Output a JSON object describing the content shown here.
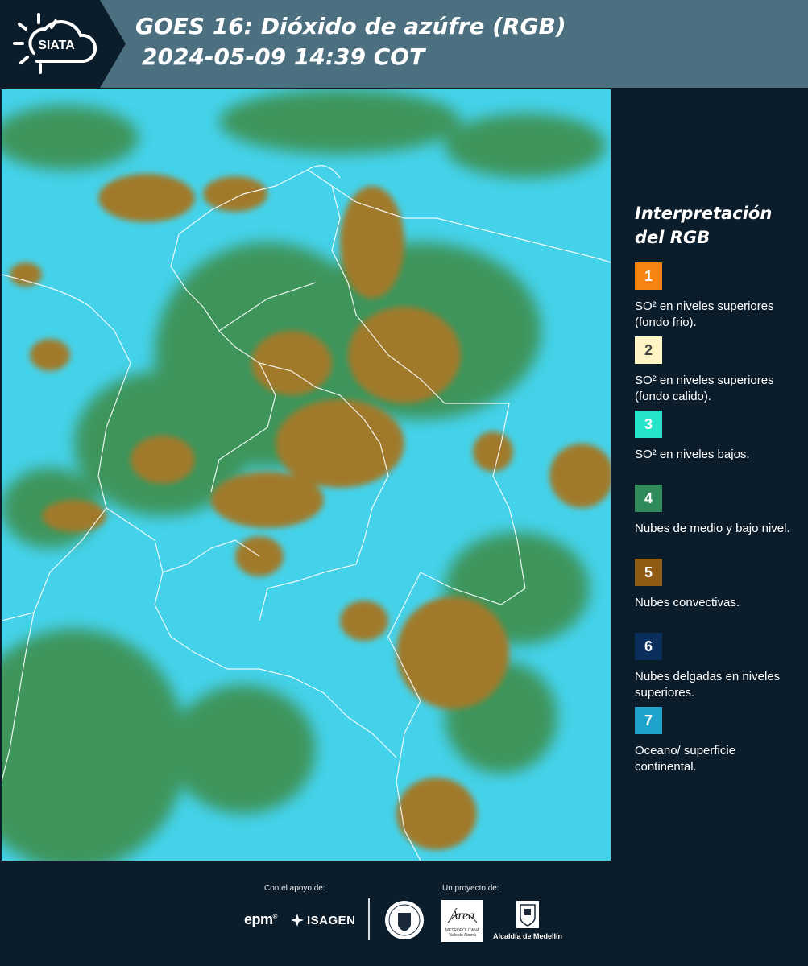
{
  "header": {
    "logo_text": "SIATA",
    "title_line1": "GOES 16: Dióxido de azúfre (RGB)",
    "title_line2": "2024-05-09 14:39 COT"
  },
  "legend": {
    "title_line1": "Interpretación",
    "title_line2": "del RGB",
    "items": [
      {
        "number": "1",
        "label": "SO² en niveles superiores (fondo frio).",
        "color": "#f58410",
        "text_color": "#ffffff"
      },
      {
        "number": "2",
        "label": "SO² en niveles superiores (fondo calido).",
        "color": "#fdf5c3",
        "text_color": "#444444"
      },
      {
        "number": "3",
        "label": "SO² en niveles bajos.",
        "color": "#23e3c8",
        "text_color": "#ffffff"
      },
      {
        "number": "4",
        "label": "Nubes de medio y bajo nivel.",
        "color": "#2f8a5c",
        "text_color": "#ffffff"
      },
      {
        "number": "5",
        "label": "Nubes convectivas.",
        "color": "#8f5b15",
        "text_color": "#ffffff"
      },
      {
        "number": "6",
        "label": "Nubes delgadas en niveles superiores.",
        "color": "#0a2f5c",
        "text_color": "#ffffff"
      },
      {
        "number": "7",
        "label": "Oceano/ superficie continental.",
        "color": "#1ea3cc",
        "text_color": "#ffffff"
      }
    ]
  },
  "footer": {
    "support_label": "Con el apoyo de:",
    "project_label": "Un proyecto de:",
    "sponsor1": "epm",
    "sponsor2": "ISAGEN",
    "partner1_line1": "Área",
    "partner1_line2": "METROPOLITANA",
    "partner1_line3": "Valle de Aburrá",
    "partner2": "Alcaldía de Medellín"
  },
  "colors": {
    "header_band": "#4d7080",
    "background": "#0b1c2a",
    "ocean_cyan": "#44d2ea",
    "cloud_brown": "#a07a2a",
    "cloud_green": "#3d8f4e"
  }
}
